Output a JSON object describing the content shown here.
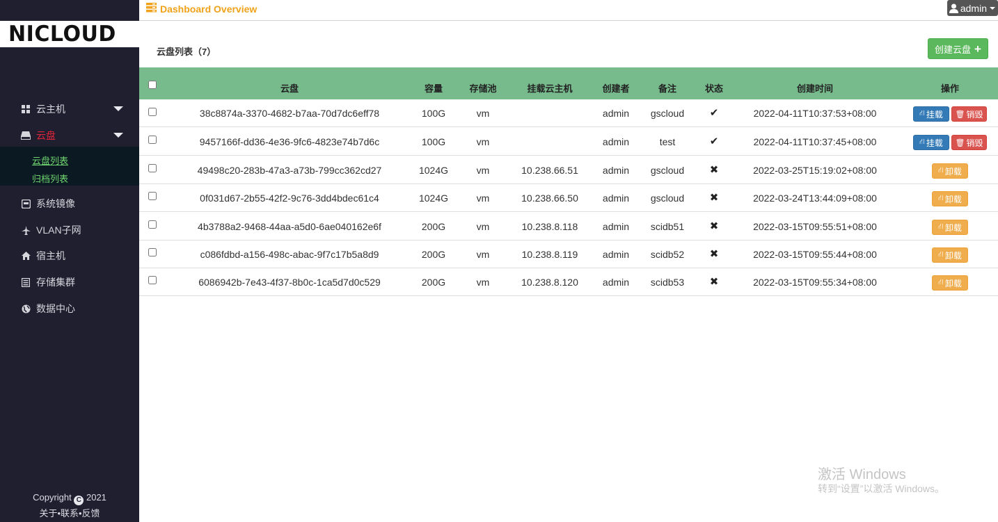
{
  "app": {
    "logo": "NICLOUD",
    "dashboard_title": "Dashboard Overview",
    "user": "admin"
  },
  "sidebar": {
    "items": [
      {
        "label": "云主机",
        "icon": "grid-icon"
      },
      {
        "label": "云盘",
        "icon": "hdd-icon"
      },
      {
        "label": "系统镜像",
        "icon": "image-icon"
      },
      {
        "label": "VLAN子网",
        "icon": "plane-icon"
      },
      {
        "label": "宿主机",
        "icon": "home-icon"
      },
      {
        "label": "存储集群",
        "icon": "list-icon"
      },
      {
        "label": "数据中心",
        "icon": "globe-icon"
      }
    ],
    "submenu": [
      {
        "label": "云盘列表"
      },
      {
        "label": "归档列表"
      }
    ],
    "footer_copyright": "Copyright",
    "footer_year": "2021",
    "footer_links": "关于•联系•反馈"
  },
  "main": {
    "list_title": "云盘列表（7）",
    "create_button": "创建云盘"
  },
  "table": {
    "columns": [
      "云盘",
      "容量",
      "存储池",
      "挂载云主机",
      "创建者",
      "备注",
      "状态",
      "创建时间",
      "操作"
    ],
    "rows": [
      {
        "id": "38c8874a-3370-4682-b7aa-70d7dc6eff78",
        "size": "100G",
        "pool": "vm",
        "host": "",
        "creator": "admin",
        "note": "gscloud",
        "status": "check",
        "created": "2022-04-11T10:37:53+08:00",
        "actions": [
          "挂载",
          "销毁"
        ]
      },
      {
        "id": "9457166f-dd36-4e36-9fc6-4823e74b7d6c",
        "size": "100G",
        "pool": "vm",
        "host": "",
        "creator": "admin",
        "note": "test",
        "status": "check",
        "created": "2022-04-11T10:37:45+08:00",
        "actions": [
          "挂载",
          "销毁"
        ]
      },
      {
        "id": "49498c20-283b-47a3-a73b-799cc362cd27",
        "size": "1024G",
        "pool": "vm",
        "host": "10.238.66.51",
        "creator": "admin",
        "note": "gscloud",
        "status": "cross",
        "created": "2022-03-25T15:19:02+08:00",
        "actions": [
          "卸载"
        ]
      },
      {
        "id": "0f031d67-2b55-42f2-9c76-3dd4bdec61c4",
        "size": "1024G",
        "pool": "vm",
        "host": "10.238.66.50",
        "creator": "admin",
        "note": "gscloud",
        "status": "cross",
        "created": "2022-03-24T13:44:09+08:00",
        "actions": [
          "卸载"
        ]
      },
      {
        "id": "4b3788a2-9468-44aa-a5d0-6ae040162e6f",
        "size": "200G",
        "pool": "vm",
        "host": "10.238.8.118",
        "creator": "admin",
        "note": "scidb51",
        "status": "cross",
        "created": "2022-03-15T09:55:51+08:00",
        "actions": [
          "卸载"
        ]
      },
      {
        "id": "c086fdbd-a156-498c-abac-9f7c17b5a8d9",
        "size": "200G",
        "pool": "vm",
        "host": "10.238.8.119",
        "creator": "admin",
        "note": "scidb52",
        "status": "cross",
        "created": "2022-03-15T09:55:44+08:00",
        "actions": [
          "卸载"
        ]
      },
      {
        "id": "6086942b-7e43-4f37-8b0c-1ca5d7d0c529",
        "size": "200G",
        "pool": "vm",
        "host": "10.238.8.120",
        "creator": "admin",
        "note": "scidb53",
        "status": "cross",
        "created": "2022-03-15T09:55:34+08:00",
        "actions": [
          "卸载"
        ]
      }
    ]
  },
  "watermark": {
    "line1": "激活 Windows",
    "line2": "转到“设置”以激活 Windows。"
  },
  "colors": {
    "sidebar_bg": "#1f1f30",
    "accent_orange": "#f0a21a",
    "table_header": "#77bb8d",
    "active_menu": "#e0243a",
    "submenu_text": "#6ed36e",
    "btn_primary": "#337ab7",
    "btn_danger": "#d9534f",
    "btn_warning": "#f0ad4e",
    "btn_success": "#5cb85c"
  }
}
